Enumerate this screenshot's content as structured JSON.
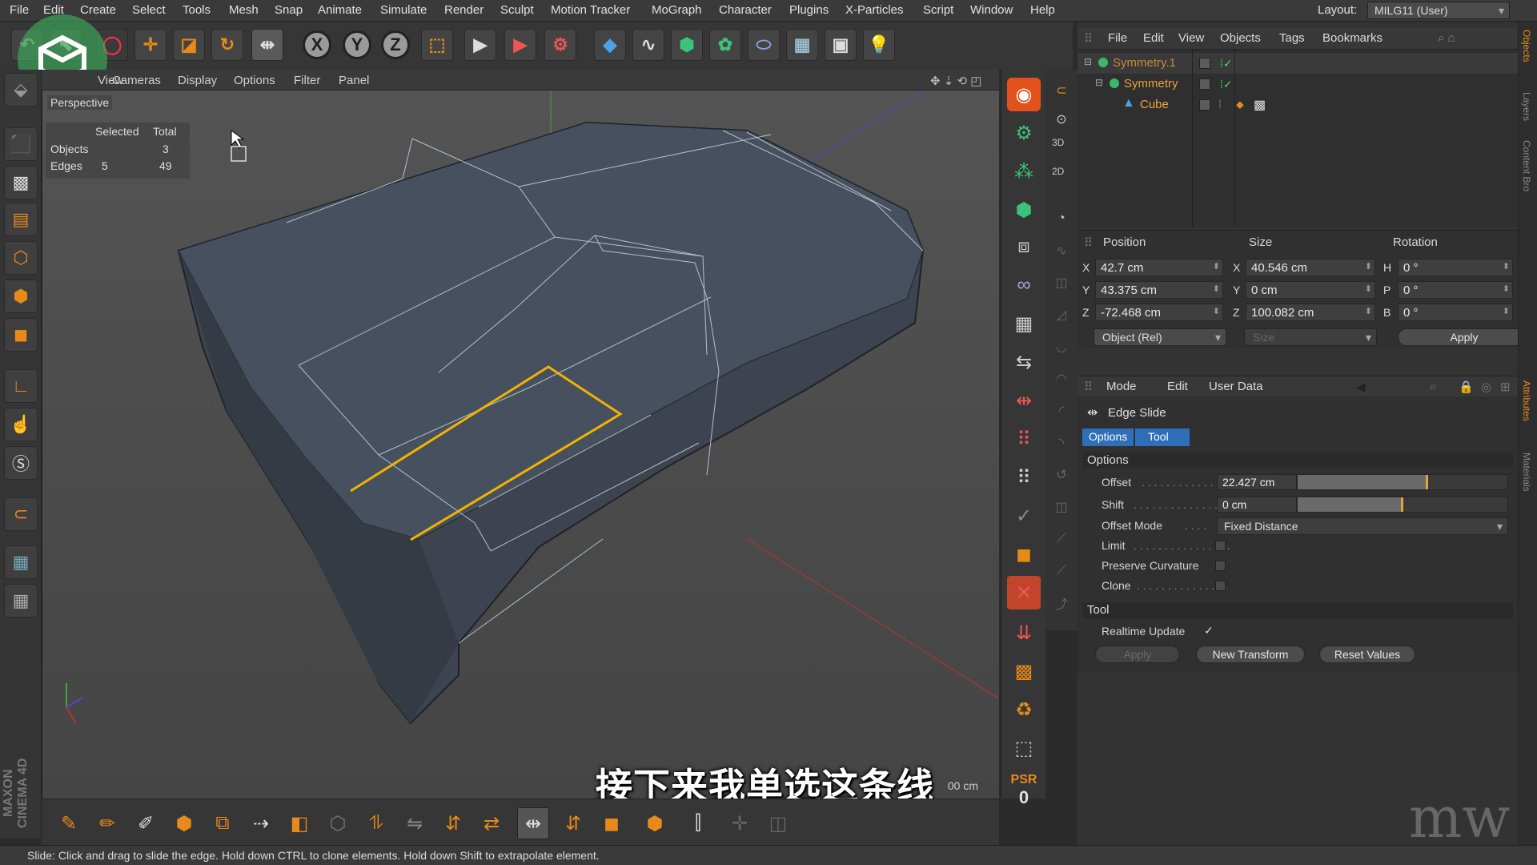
{
  "menubar": {
    "items": [
      "File",
      "Edit",
      "Create",
      "Select",
      "Tools",
      "Mesh",
      "Snap",
      "Animate",
      "Simulate",
      "Render",
      "Sculpt",
      "Motion Tracker",
      "MoGraph",
      "Character",
      "Plugins",
      "X-Particles",
      "Script",
      "Window",
      "Help"
    ],
    "layout_label": "Layout:",
    "layout_value": "MILG11 (User)"
  },
  "toolbar": {
    "axis_x": "X",
    "axis_y": "Y",
    "axis_z": "Z"
  },
  "viewport": {
    "menu": [
      "View",
      "Cameras",
      "Display",
      "Options",
      "Filter",
      "Panel"
    ],
    "label": "Perspective",
    "hud": {
      "col_selected": "Selected",
      "col_total": "Total",
      "rows": [
        {
          "label": "Objects",
          "selected": "",
          "total": "3"
        },
        {
          "label": "Edges",
          "selected": "5",
          "total": "49"
        }
      ]
    },
    "unit_readout": "00 cm",
    "subtitle": "接下来我单选这条线",
    "highlight_color": "#f0b400"
  },
  "objects_manager": {
    "menu": [
      "File",
      "Edit",
      "View",
      "Objects",
      "Tags",
      "Bookmarks"
    ],
    "rows": [
      {
        "name": "Symmetry.1"
      },
      {
        "name": "Symmetry"
      },
      {
        "name": "Cube"
      }
    ]
  },
  "coordinates": {
    "headers": {
      "position": "Position",
      "size": "Size",
      "rotation": "Rotation"
    },
    "position": [
      {
        "axis": "X",
        "value": "42.7 cm"
      },
      {
        "axis": "Y",
        "value": "43.375 cm"
      },
      {
        "axis": "Z",
        "value": "-72.468 cm"
      }
    ],
    "size": [
      {
        "axis": "X",
        "value": "40.546 cm"
      },
      {
        "axis": "Y",
        "value": "0 cm"
      },
      {
        "axis": "Z",
        "value": "100.082 cm"
      }
    ],
    "rotation": [
      {
        "axis": "H",
        "value": "0 °"
      },
      {
        "axis": "P",
        "value": "0 °"
      },
      {
        "axis": "B",
        "value": "0 °"
      }
    ],
    "mode_dropdown": "Object (Rel)",
    "size_dropdown": "Size",
    "apply_label": "Apply"
  },
  "attributes": {
    "menu": [
      "Mode",
      "Edit",
      "User Data"
    ],
    "tool_name": "Edge Slide",
    "tabs": [
      "Options",
      "Tool"
    ],
    "options_section": "Options",
    "offset_label": "Offset",
    "offset_value": "22.427 cm",
    "offset_slider": 0.62,
    "shift_label": "Shift",
    "shift_value": "0 cm",
    "shift_slider": 0.5,
    "offset_mode_label": "Offset Mode",
    "offset_mode_value": "Fixed Distance",
    "limit_label": "Limit",
    "preserve_label": "Preserve Curvature",
    "clone_label": "Clone",
    "tool_section": "Tool",
    "realtime_label": "Realtime Update",
    "realtime_check": "✓",
    "apply_label": "Apply",
    "new_transform_label": "New Transform",
    "reset_label": "Reset Values"
  },
  "right_toolbar": {
    "psr_label": "PSR",
    "psr_value": "0"
  },
  "sidetabs": [
    "Objects",
    "Layers",
    "Content Bro",
    "Attributes",
    "Materials"
  ],
  "vertical_labels": {
    "mode_3d": "3D",
    "mode_2d": "2D"
  },
  "status": "Slide: Click and drag to slide the edge. Hold down CTRL to clone elements. Hold down Shift to extrapolate element.",
  "branding": {
    "maxon": "MAXON CINEMA 4D"
  }
}
